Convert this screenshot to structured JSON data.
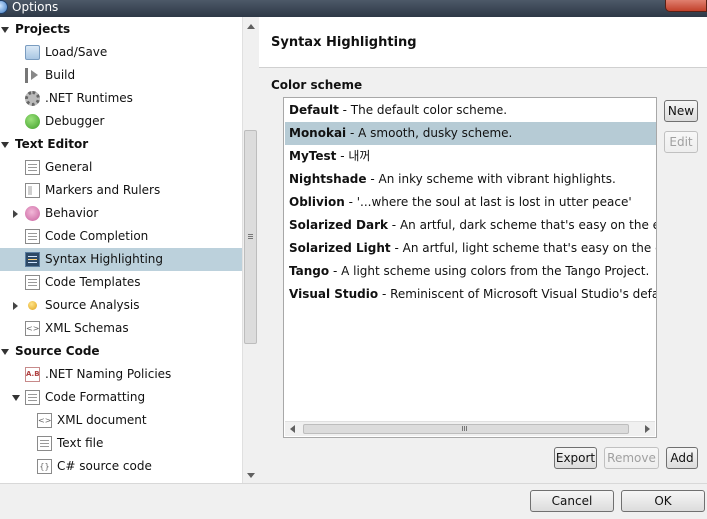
{
  "window": {
    "title": "Options"
  },
  "tree": {
    "items": [
      {
        "label": "Projects",
        "group": true,
        "expanded": true,
        "icon": "arrow-down"
      },
      {
        "label": "Load/Save",
        "icon": "load-save-icon"
      },
      {
        "label": "Build",
        "icon": "build-icon"
      },
      {
        "label": ".NET Runtimes",
        "icon": "gear-icon"
      },
      {
        "label": "Debugger",
        "icon": "bug-icon"
      },
      {
        "label": "Text Editor",
        "group": true,
        "expanded": true,
        "icon": "arrow-down"
      },
      {
        "label": "General",
        "icon": "document-icon"
      },
      {
        "label": "Markers and Rulers",
        "icon": "markers-icon"
      },
      {
        "label": "Behavior",
        "icon": "brain-icon",
        "collapsed": true
      },
      {
        "label": "Code Completion",
        "icon": "document-icon"
      },
      {
        "label": "Syntax Highlighting",
        "icon": "syntax-icon",
        "selected": true
      },
      {
        "label": "Code Templates",
        "icon": "document-icon"
      },
      {
        "label": "Source Analysis",
        "icon": "dot-icon",
        "collapsed": true
      },
      {
        "label": "XML Schemas",
        "icon": "code-icon"
      },
      {
        "label": "Source Code",
        "group": true,
        "expanded": true,
        "icon": "arrow-down"
      },
      {
        "label": ".NET Naming Policies",
        "icon": "naming-icon"
      },
      {
        "label": "Code Formatting",
        "icon": "document-icon",
        "expanded": true
      },
      {
        "label": "XML document",
        "icon": "code-icon"
      },
      {
        "label": "Text file",
        "icon": "document-icon"
      },
      {
        "label": "C# source code",
        "icon": "braces-icon"
      }
    ]
  },
  "panel": {
    "title": "Syntax Highlighting",
    "section_label": "Color scheme",
    "schemes": [
      {
        "name": "Default",
        "desc": " - The default color scheme."
      },
      {
        "name": "Monokai",
        "desc": " - A smooth, dusky scheme.",
        "selected": true
      },
      {
        "name": "MyTest",
        "desc": " - 내꺼"
      },
      {
        "name": "Nightshade",
        "desc": " - An inky scheme with vibrant highlights."
      },
      {
        "name": "Oblivion",
        "desc": " - '...where the soul at last is lost in utter peace'"
      },
      {
        "name": "Solarized Dark",
        "desc": " - An artful, dark scheme that's easy on the eyes."
      },
      {
        "name": "Solarized Light",
        "desc": " - An artful, light scheme that's easy on the eyes."
      },
      {
        "name": "Tango",
        "desc": " - A light scheme using colors from the Tango Project."
      },
      {
        "name": "Visual Studio",
        "desc": " - Reminiscent of Microsoft Visual Studio's default colors"
      }
    ],
    "buttons": {
      "new": "New",
      "edit": "Edit",
      "export": "Export",
      "remove": "Remove",
      "add": "Add"
    }
  },
  "footer": {
    "cancel": "Cancel",
    "ok": "OK"
  },
  "colors": {
    "selection": "#bcd1dc",
    "titlebar": "#3a4656"
  }
}
